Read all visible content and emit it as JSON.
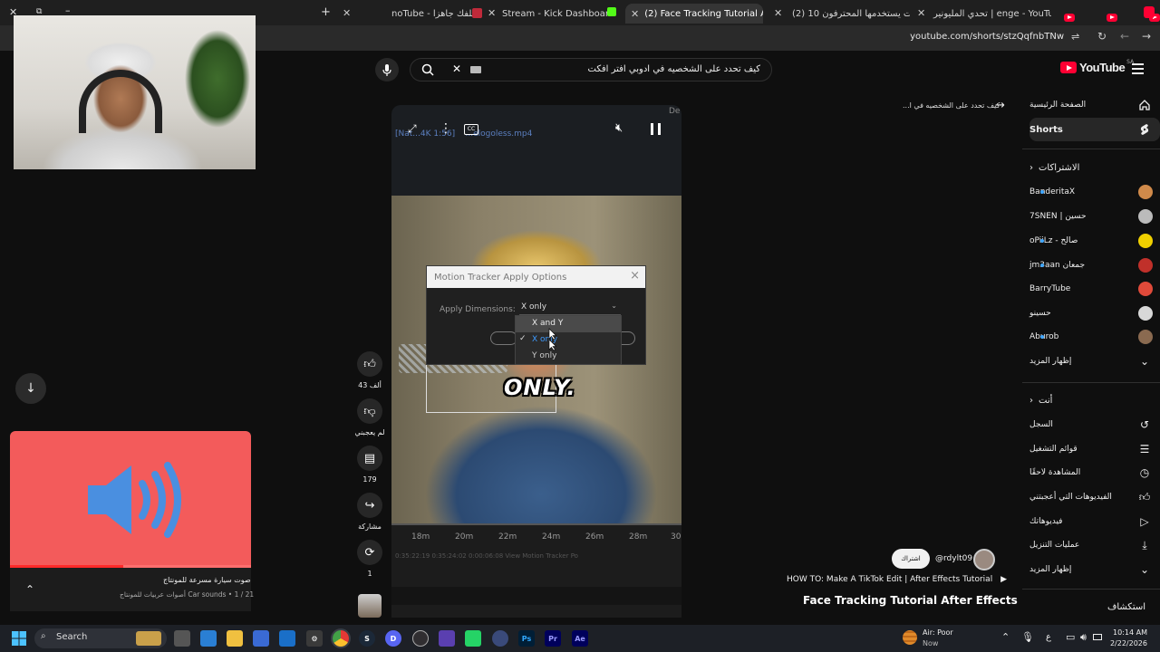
{
  "browser": {
    "tabs": [
      {
        "label": "noTube - ملفك جاهزا",
        "active": false
      },
      {
        "label": "Stream - Kick Dashboard",
        "active": false
      },
      {
        "label": "(2) Face Tracking Tutorial After E",
        "active": true
      },
      {
        "label": "(2) 10 مهارات يستخدمها المحترفون",
        "active": false
      },
      {
        "label": "تحدي المليونير | enge - YouTube",
        "active": false
      }
    ],
    "new_tab": "+",
    "url": "youtube.com/shorts/stzQqfnbTNw"
  },
  "youtube": {
    "search_query": "كيف تحدد على الشخصيه في ادوبي افتر افكت",
    "logo_text": "YouTube",
    "logo_region": "SA",
    "back_title": "كيف تحدد على الشخصيه في ا..."
  },
  "sidebar": {
    "main": [
      {
        "label": "الصفحة الرئيسية",
        "icon": "home-icon"
      },
      {
        "label": "Shorts",
        "icon": "shorts-icon",
        "active": true
      }
    ],
    "subscriptions_header": "الاشتراكات",
    "subscriptions": [
      {
        "label": "BanderitaX",
        "live": true,
        "color": "#d08a4a"
      },
      {
        "label": "حسين | 7SNEN",
        "live": false,
        "color": "#bbbbbb"
      },
      {
        "label": "صالح - oPiiLz",
        "live": true,
        "color": "#f0d000"
      },
      {
        "label": "جمعان jm3aan",
        "live": true,
        "color": "#c0302a"
      },
      {
        "label": "BarryTube",
        "live": false,
        "color": "#e04a3a"
      },
      {
        "label": "حسينو",
        "live": false,
        "color": "#d8d8d8"
      },
      {
        "label": "Aburob",
        "live": true,
        "color": "#8a6a50"
      }
    ],
    "show_more_1": "إظهار المزيد",
    "you_header": "أنت",
    "you_items": [
      {
        "label": "السجل",
        "icon": "history-icon"
      },
      {
        "label": "قوائم التشغيل",
        "icon": "playlists-icon"
      },
      {
        "label": "المشاهدة لاحقًا",
        "icon": "watch-later-icon"
      },
      {
        "label": "الفيديوهات التي أعجبتني",
        "icon": "liked-videos-icon"
      },
      {
        "label": "فيديوهاتك",
        "icon": "your-videos-icon"
      },
      {
        "label": "عمليات التنزيل",
        "icon": "downloads-icon"
      }
    ],
    "show_more_2": "إظهار المزيد",
    "explore_header": "استكشاف"
  },
  "video": {
    "ae_tab": "[Nat...4K 1:56]     ...elogoless.mp4",
    "ae_corner": "De",
    "dialog_title": "Motion Tracker Apply Options",
    "dialog_close": "×",
    "dim_label": "Apply Dimensions:",
    "dim_value": "X only",
    "dropdown_options": [
      {
        "label": "X and Y",
        "state": "hover"
      },
      {
        "label": "X only",
        "state": "selected"
      },
      {
        "label": "Y only",
        "state": "normal"
      }
    ],
    "caption": "ONLY.",
    "timeline_labels": [
      "18m",
      "20m",
      "22m",
      "24m",
      "26m",
      "28m",
      "30"
    ],
    "timeline_sub": "0:35:22:19   0:35:24:02   0:00:06:08   View   Motion Tracker Po"
  },
  "actions": {
    "likes": "43 ألف",
    "dislike": "لم يعجبني",
    "comments": "179",
    "share": "مشاركة",
    "remix": "1"
  },
  "short_info": {
    "subscribe": "اشتراك",
    "channel": "@rdylt09",
    "music": "HOW TO: Make A TikTok Edit | After Effects Tutorial",
    "title": "Face Tracking Tutorial After Effects"
  },
  "audio_widget": {
    "title": "صوت سيارة مسرعة للمونتاج",
    "subtitle": "أصوات عربيات للمونتاج Car sounds • 1 / 21",
    "progress": 0.47
  },
  "taskbar": {
    "search": "Search",
    "air_title": "Air: Poor",
    "air_sub": "Now",
    "time": "10:14 AM",
    "date": "2/22/2026",
    "lang": "ع"
  }
}
